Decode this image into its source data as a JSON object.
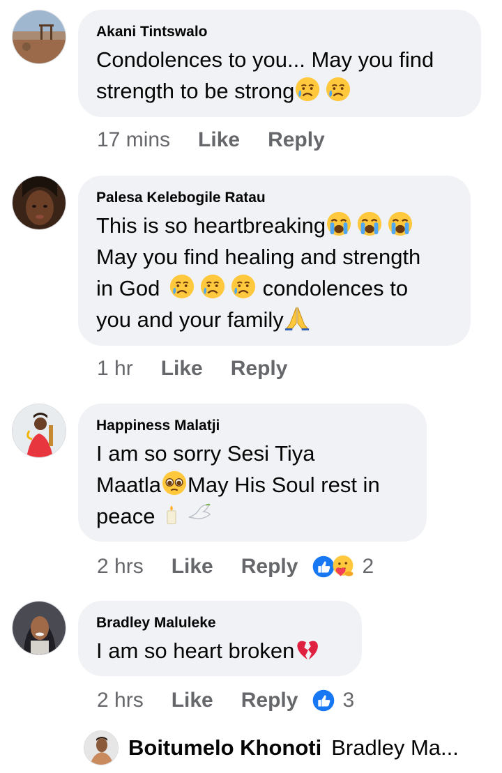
{
  "comments": [
    {
      "author": "Akani Tintswalo",
      "lines": [
        "Condolences to you... May you find",
        "strength to be strong"
      ],
      "time": "17 mins",
      "like_label": "Like",
      "reply_label": "Reply"
    },
    {
      "author": "Palesa Kelebogile Ratau",
      "lines": [
        "This is so heartbreaking",
        "May you find healing and strength",
        "in God",
        "condolences to",
        "you and your family"
      ],
      "time": "1 hr",
      "like_label": "Like",
      "reply_label": "Reply"
    },
    {
      "author": "Happiness Malatji",
      "lines": [
        "I am so sorry Sesi Tiya",
        "Maatla",
        "May His Soul rest in",
        "peace"
      ],
      "time": "2 hrs",
      "like_label": "Like",
      "reply_label": "Reply",
      "reaction_count": "2"
    },
    {
      "author": "Bradley Maluleke",
      "lines": [
        "I am so heart broken"
      ],
      "time": "2 hrs",
      "like_label": "Like",
      "reply_label": "Reply",
      "reaction_count": "3"
    }
  ],
  "reply_preview": {
    "author": "Boitumelo Khonoti",
    "text": "Bradley Ma..."
  },
  "icons": {
    "crying": "sad-but-relieved-face-icon",
    "sobbing": "loudly-crying-face-icon",
    "pleading": "pleading-face-icon",
    "candle": "candle-icon",
    "dove": "dove-icon",
    "pray": "folded-hands-icon",
    "like_reaction": "like-reaction-icon",
    "care_reaction": "care-reaction-icon",
    "broken_heart": "broken-heart-icon"
  },
  "colors": {
    "bubble": "#f0f2f5",
    "meta_text": "#65676b",
    "like_blue": "#1877f2"
  }
}
